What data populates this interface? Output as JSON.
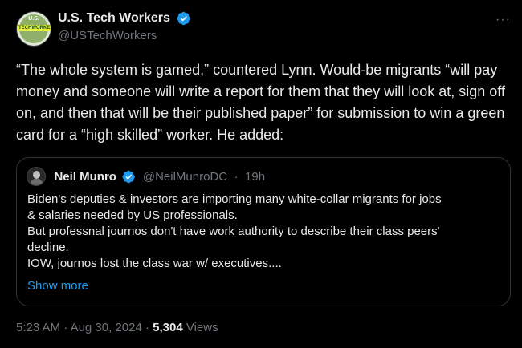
{
  "author": {
    "display_name": "U.S. Tech Workers",
    "handle": "@USTechWorkers",
    "avatar_text_top": "U.S.",
    "avatar_text_band": "TECHWORKERS",
    "avatar_icon": "org-logo"
  },
  "more_icon": "ellipsis-icon",
  "tweet": {
    "text": "“The whole system is gamed,” countered Lynn. Would-be migrants “will pay money and someone will write a report for them that they will look at, sign off on, and then that will be their published paper” for submission to win a green card for a “high skilled” worker. He added:"
  },
  "quote": {
    "display_name": "Neil Munro",
    "handle": "@NeilMunroDC",
    "separator": "·",
    "time": "19h",
    "lines": [
      "Biden's deputies & investors are importing many white-collar migrants for jobs",
      "& salaries needed by US professionals.",
      "But professnal journos don't have work authority to describe their class peers'",
      "decline.",
      "IOW, journos lost the class war w/ executives...."
    ],
    "show_more": "Show more"
  },
  "meta": {
    "time": "5:23 AM",
    "sep1": "·",
    "date": "Aug 30, 2024",
    "sep2": "·",
    "views_count": "5,304",
    "views_label": "Views"
  },
  "colors": {
    "background": "#000000",
    "text": "#e7e9ea",
    "secondary": "#71767b",
    "accent": "#1d9bf0",
    "border": "#2f3336"
  }
}
